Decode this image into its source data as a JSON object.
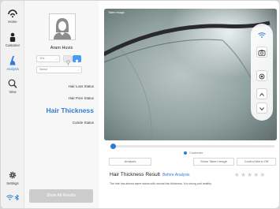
{
  "nav": {
    "items": [
      {
        "label": "Home",
        "icon": "home-icon"
      },
      {
        "label": "Customer",
        "icon": "customer-icon"
      },
      {
        "label": "Analysis",
        "icon": "analysis-icon",
        "active": true
      },
      {
        "label": "View",
        "icon": "view-icon"
      }
    ],
    "settings_label": "Settings"
  },
  "profile": {
    "name": "Aram Huvis",
    "age_value": "10's",
    "select_placeholder": "Select"
  },
  "menu": {
    "items": [
      "Hair Loss Status",
      "Hair Pore Status",
      "Hair Thickness",
      "Cuticle Status"
    ],
    "selected": "Hair Thickness"
  },
  "show_all_label": "Show All Results",
  "camera": {
    "label": "Taken Image",
    "customer_label": "Customer",
    "slider_level": 0.02
  },
  "actions": {
    "analysis": "Analysis",
    "show_taken": "Show Taken Image",
    "control_menu": "Control Menu Off"
  },
  "result": {
    "title": "Hair Thickness Result",
    "before": "Before Analysis",
    "description": "The hair has almost same status with normal hair thickness. It is strong and healthy.",
    "stars_filled": 0,
    "stars_total": 5
  },
  "colors": {
    "accent": "#2e7bd6",
    "disabled": "#cccccc"
  }
}
